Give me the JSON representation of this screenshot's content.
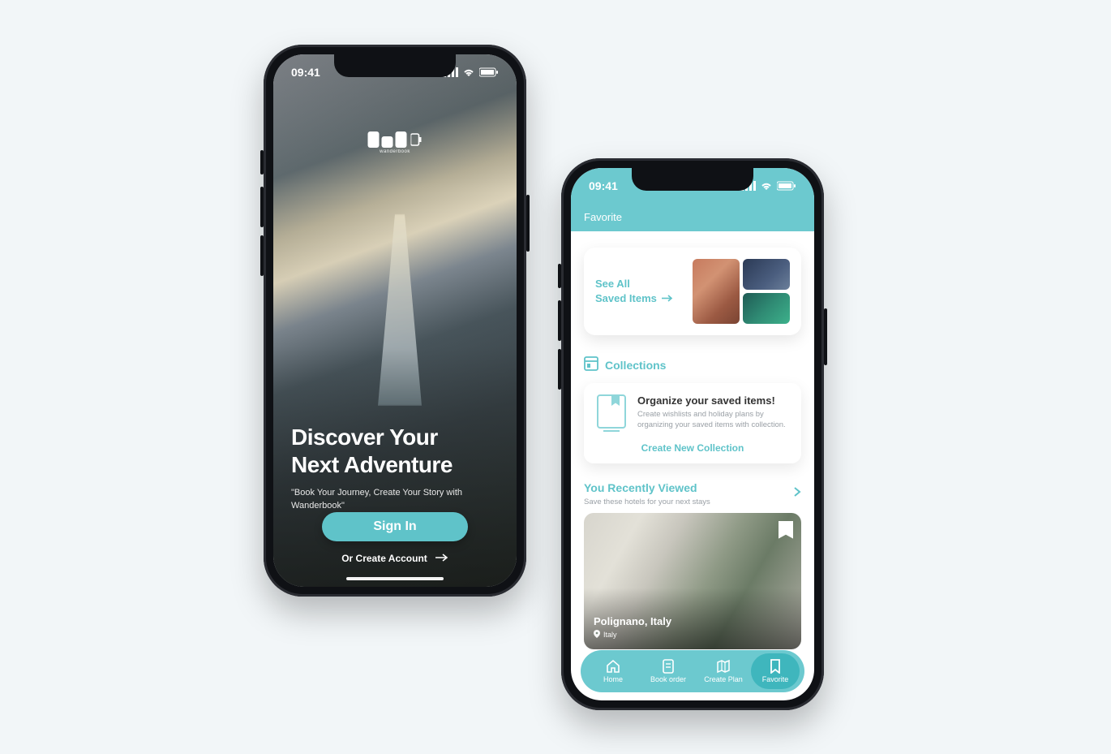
{
  "colors": {
    "accent": "#5fc3c9",
    "accentBg": "#6cc9cf"
  },
  "status_time": "09:41",
  "screen1": {
    "logo_text": "wanderbook",
    "title_line1": "Discover Your",
    "title_line2": "Next Adventure",
    "tagline": "\"Book Your Journey, Create Your Story with Wanderbook\"",
    "signin_label": "Sign In",
    "create_label": "Or Create Account"
  },
  "screen2": {
    "header_title": "Favorite",
    "saved": {
      "line1": "See All",
      "line2": "Saved Items"
    },
    "collections": {
      "heading": "Collections",
      "card_title": "Organize your saved items!",
      "card_sub": "Create wishlists and holiday plans by organizing your saved items with collection.",
      "cta": "Create New Collection"
    },
    "recent": {
      "heading": "You Recently Viewed",
      "sub": "Save these hotels for your next stays",
      "card_title": "Polignano, Italy",
      "card_country": "Italy"
    },
    "tabs": [
      {
        "label": "Home"
      },
      {
        "label": "Book order"
      },
      {
        "label": "Create Plan"
      },
      {
        "label": "Favorite"
      }
    ],
    "active_tab_index": 3
  }
}
